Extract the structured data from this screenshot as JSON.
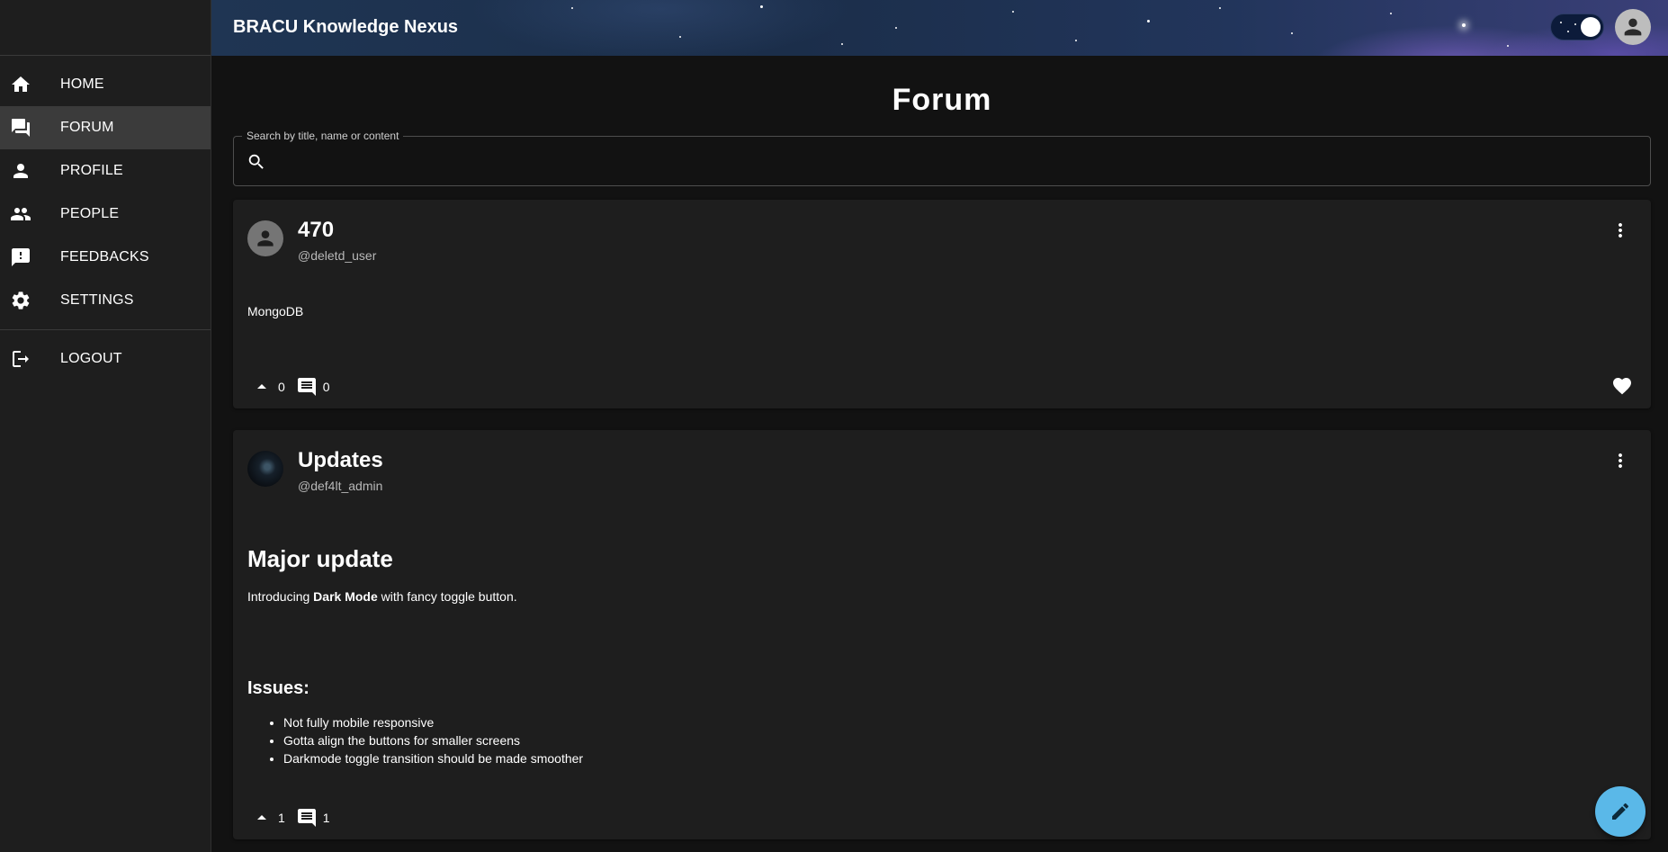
{
  "app": {
    "title": "BRACU Knowledge Nexus"
  },
  "sidebar": {
    "items": [
      {
        "label": "HOME",
        "icon": "home-icon",
        "active": false
      },
      {
        "label": "FORUM",
        "icon": "forum-icon",
        "active": true
      },
      {
        "label": "PROFILE",
        "icon": "person-icon",
        "active": false
      },
      {
        "label": "PEOPLE",
        "icon": "people-icon",
        "active": false
      },
      {
        "label": "FEEDBACKS",
        "icon": "feedback-icon",
        "active": false
      },
      {
        "label": "SETTINGS",
        "icon": "gear-icon",
        "active": false
      }
    ],
    "logout": {
      "label": "LOGOUT",
      "icon": "logout-icon"
    }
  },
  "header": {
    "dark_mode_on": true
  },
  "page": {
    "title": "Forum"
  },
  "search": {
    "label": "Search by title, name or content",
    "value": "",
    "placeholder": ""
  },
  "posts": [
    {
      "title": "470",
      "user": "@deletd_user",
      "content": "MongoDB",
      "upvotes": "0",
      "comments": "0"
    },
    {
      "title": "Updates",
      "user": "@def4lt_admin",
      "heading": "Major update",
      "intro_pre": "Introducing ",
      "intro_bold": "Dark Mode",
      "intro_post": " with fancy toggle button.",
      "subheading": "Issues:",
      "issues": [
        "Not fully mobile responsive",
        "Gotta align the buttons for smaller screens",
        "Darkmode toggle transition should be made smoother"
      ],
      "upvotes": "1",
      "comments": "1"
    }
  ],
  "colors": {
    "background": "#121212",
    "card": "#1e1e1e",
    "accent": "#5ab8e8"
  }
}
